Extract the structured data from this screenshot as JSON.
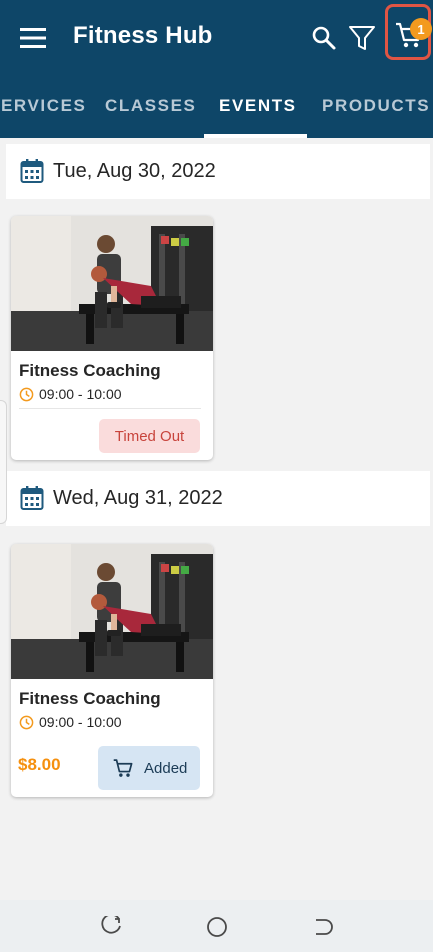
{
  "app": {
    "title": "Fitness Hub",
    "cart_count": "1"
  },
  "tabs": [
    {
      "label": "SERVICES"
    },
    {
      "label": "CLASSES"
    },
    {
      "label": "EVENTS",
      "active": true
    },
    {
      "label": "PRODUCTS"
    }
  ],
  "days": [
    {
      "date": "Tue, Aug 30, 2022",
      "event": {
        "name": "Fitness Coaching",
        "time": "09:00 - 10:00",
        "status": "Timed Out"
      }
    },
    {
      "date": "Wed, Aug 31, 2022",
      "event": {
        "name": "Fitness Coaching",
        "time": "09:00 - 10:00",
        "price": "$8.00",
        "cart_label": "Added"
      }
    }
  ],
  "colors": {
    "primary": "#0e4668",
    "accent_orange": "#f39a1e",
    "timed_out_bg": "#fadcdc",
    "timed_out_text": "#c8443c",
    "added_bg": "#d6e5f3",
    "price": "#f5900f"
  },
  "icons": {
    "menu": "hamburger-menu-icon",
    "search": "search-icon",
    "filter": "filter-icon",
    "cart": "cart-icon",
    "calendar": "calendar-icon",
    "clock": "clock-icon",
    "nav_recent": "recent-apps-icon",
    "nav_home": "home-icon",
    "nav_back": "back-icon"
  }
}
